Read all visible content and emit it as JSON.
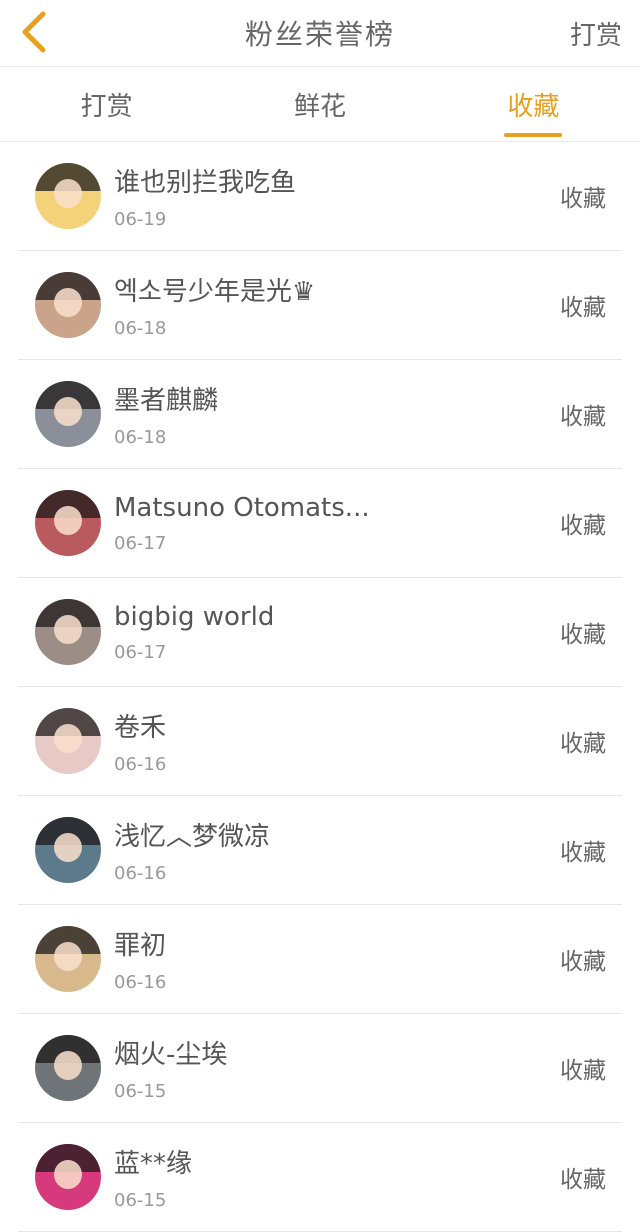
{
  "header": {
    "title": "粉丝荣誉榜",
    "reward_label": "打赏",
    "back_color": "#e8a020"
  },
  "tabs": [
    {
      "label": "打赏",
      "active": false
    },
    {
      "label": "鲜花",
      "active": false
    },
    {
      "label": "收藏",
      "active": true
    }
  ],
  "accent_color": "#e8a020",
  "items": [
    {
      "name": "谁也别拦我吃鱼",
      "date": "06-19",
      "action": "收藏",
      "avatar_color": "#f3d27a"
    },
    {
      "name": "엑소号少年是光♛",
      "date": "06-18",
      "action": "收藏",
      "avatar_color": "#c9a48a"
    },
    {
      "name": "墨者麒麟",
      "date": "06-18",
      "action": "收藏",
      "avatar_color": "#8a8f9a"
    },
    {
      "name": "Matsuno Otomats...",
      "date": "06-17",
      "action": "收藏",
      "avatar_color": "#b85a5e"
    },
    {
      "name": "bigbig world",
      "date": "06-17",
      "action": "收藏",
      "avatar_color": "#9c8d86"
    },
    {
      "name": "卷禾",
      "date": "06-16",
      "action": "收藏",
      "avatar_color": "#e7c9c6"
    },
    {
      "name": "浅忆︿梦微凉",
      "date": "06-16",
      "action": "收藏",
      "avatar_color": "#5d7a8c"
    },
    {
      "name": "罪初",
      "date": "06-16",
      "action": "收藏",
      "avatar_color": "#d7b98c"
    },
    {
      "name": "烟火-尘埃",
      "date": "06-15",
      "action": "收藏",
      "avatar_color": "#6e7478"
    },
    {
      "name": "蓝**缘",
      "date": "06-15",
      "action": "收藏",
      "avatar_color": "#d63a7c"
    }
  ]
}
